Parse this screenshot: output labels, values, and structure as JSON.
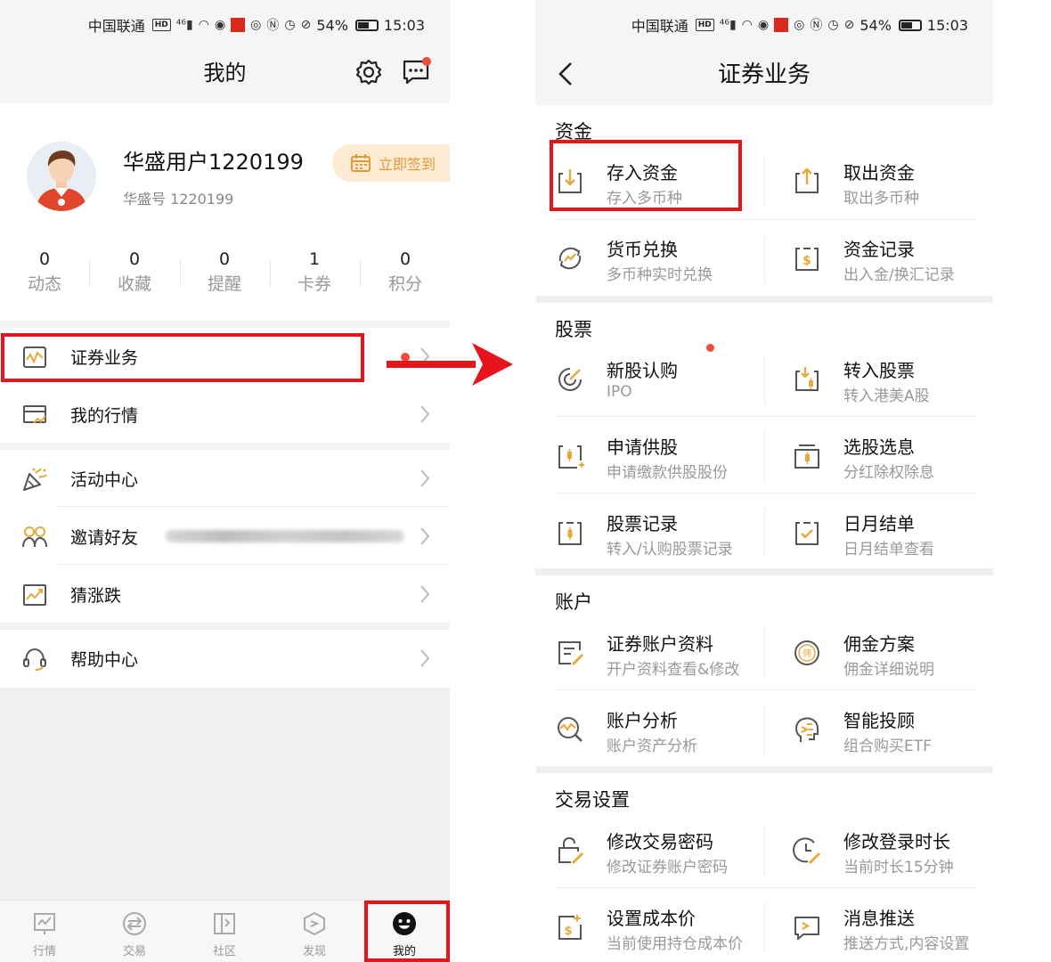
{
  "status_bar": {
    "carrier": "中国联通",
    "hd": "HD",
    "network": "⁴⁶",
    "battery": "54%",
    "time": "15:03"
  },
  "left": {
    "header_title": "我的",
    "profile": {
      "name": "华盛用户1220199",
      "id_text": "华盛号 1220199",
      "checkin_label": "立即签到"
    },
    "stats": [
      {
        "value": "0",
        "label": "动态"
      },
      {
        "value": "0",
        "label": "收藏"
      },
      {
        "value": "0",
        "label": "提醒"
      },
      {
        "value": "1",
        "label": "卡券"
      },
      {
        "value": "0",
        "label": "积分"
      }
    ],
    "menu": {
      "securities": "证券业务",
      "my_quotes": "我的行情",
      "activity": "活动中心",
      "invite": "邀请好友",
      "guess": "猜涨跌",
      "help": "帮助中心"
    },
    "tabs": [
      {
        "label": "行情"
      },
      {
        "label": "交易"
      },
      {
        "label": "社区"
      },
      {
        "label": "发现"
      },
      {
        "label": "我的"
      }
    ]
  },
  "right": {
    "header_title": "证券业务",
    "sections": {
      "funds": {
        "title": "资金",
        "items": [
          {
            "title": "存入资金",
            "sub": "存入多币种"
          },
          {
            "title": "取出资金",
            "sub": "取出多币种"
          },
          {
            "title": "货币兑换",
            "sub": "多币种实时兑换"
          },
          {
            "title": "资金记录",
            "sub": "出入金/换汇记录"
          }
        ]
      },
      "stocks": {
        "title": "股票",
        "items": [
          {
            "title": "新股认购",
            "sub": "IPO"
          },
          {
            "title": "转入股票",
            "sub": "转入港美A股"
          },
          {
            "title": "申请供股",
            "sub": "申请缴款供股股份"
          },
          {
            "title": "选股选息",
            "sub": "分红除权除息"
          },
          {
            "title": "股票记录",
            "sub": "转入/认购股票记录"
          },
          {
            "title": "日月结单",
            "sub": "日月结单查看"
          }
        ]
      },
      "account": {
        "title": "账户",
        "items": [
          {
            "title": "证券账户资料",
            "sub": "开户资料查看&修改"
          },
          {
            "title": "佣金方案",
            "sub": "佣金详细说明"
          },
          {
            "title": "账户分析",
            "sub": "账户资产分析"
          },
          {
            "title": "智能投顾",
            "sub": "组合购买ETF"
          }
        ]
      },
      "trade_settings": {
        "title": "交易设置",
        "items": [
          {
            "title": "修改交易密码",
            "sub": "修改证券账户密码"
          },
          {
            "title": "修改登录时长",
            "sub": "当前时长15分钟"
          },
          {
            "title": "设置成本价",
            "sub": "当前使用持仓成本价"
          },
          {
            "title": "消息推送",
            "sub": "推送方式,内容设置"
          }
        ]
      }
    }
  },
  "colors": {
    "accent": "#e29a39",
    "highlight": "#e8141b",
    "icon_gray": "#555555",
    "icon_gold": "#e8a93c",
    "dot": "#f04b3c"
  }
}
